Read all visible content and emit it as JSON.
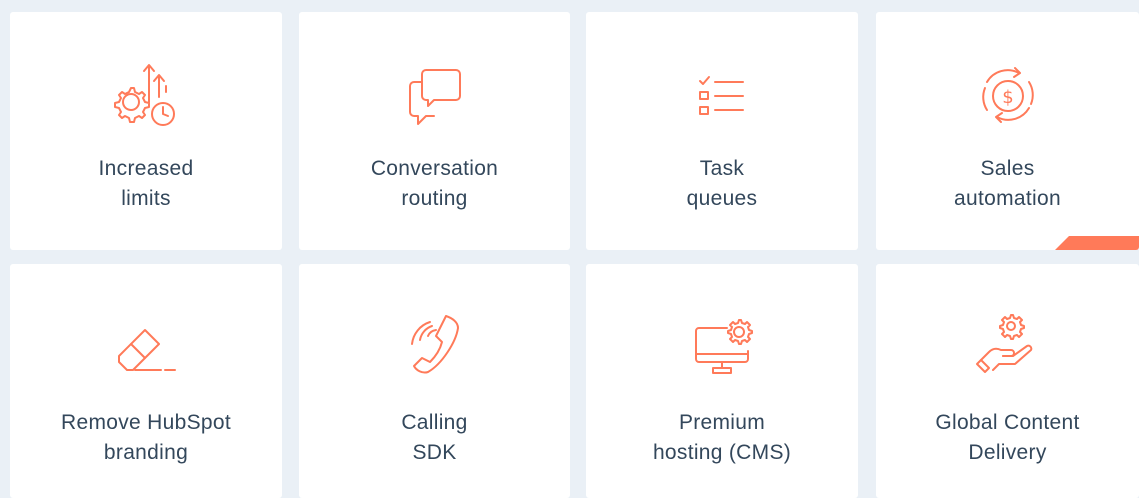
{
  "features": [
    {
      "line1": "Increased",
      "line2": "limits",
      "icon": "gears-arrows-clock-icon"
    },
    {
      "line1": "Conversation",
      "line2": "routing",
      "icon": "chat-bubbles-icon"
    },
    {
      "line1": "Task",
      "line2": "queues",
      "icon": "checklist-icon"
    },
    {
      "line1": "Sales",
      "line2": "automation",
      "icon": "dollar-cycle-icon"
    },
    {
      "line1": "Remove HubSpot",
      "line2": "branding",
      "icon": "eraser-icon"
    },
    {
      "line1": "Calling",
      "line2": "SDK",
      "icon": "phone-icon"
    },
    {
      "line1": "Premium",
      "line2": "hosting (CMS)",
      "icon": "monitor-gear-icon"
    },
    {
      "line1": "Global Content",
      "line2": "Delivery",
      "icon": "hand-gear-icon"
    }
  ],
  "colors": {
    "accent": "#ff7a59",
    "text": "#33475b",
    "background": "#eaf0f6",
    "card": "#ffffff"
  }
}
